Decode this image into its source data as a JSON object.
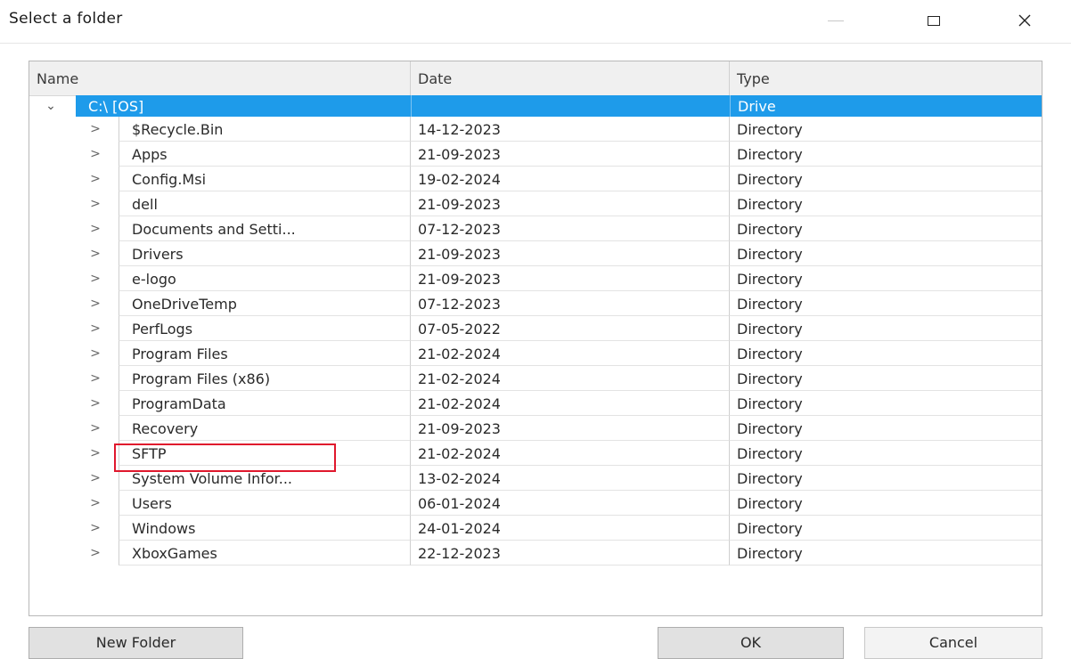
{
  "window": {
    "title": "Select a folder"
  },
  "columns": {
    "name": "Name",
    "date": "Date",
    "type": "Type"
  },
  "drive": {
    "name": "C:\\ [OS]",
    "type": "Drive",
    "selected": true
  },
  "folders": [
    {
      "name": "$Recycle.Bin",
      "date": "14-12-2023",
      "type": "Directory"
    },
    {
      "name": "Apps",
      "date": "21-09-2023",
      "type": "Directory"
    },
    {
      "name": "Config.Msi",
      "date": "19-02-2024",
      "type": "Directory"
    },
    {
      "name": "dell",
      "date": "21-09-2023",
      "type": "Directory"
    },
    {
      "name": "Documents and Setti...",
      "date": "07-12-2023",
      "type": "Directory"
    },
    {
      "name": "Drivers",
      "date": "21-09-2023",
      "type": "Directory"
    },
    {
      "name": "e-logo",
      "date": "21-09-2023",
      "type": "Directory"
    },
    {
      "name": "OneDriveTemp",
      "date": "07-12-2023",
      "type": "Directory"
    },
    {
      "name": "PerfLogs",
      "date": "07-05-2022",
      "type": "Directory"
    },
    {
      "name": "Program Files",
      "date": "21-02-2024",
      "type": "Directory"
    },
    {
      "name": "Program Files (x86)",
      "date": "21-02-2024",
      "type": "Directory"
    },
    {
      "name": "ProgramData",
      "date": "21-02-2024",
      "type": "Directory"
    },
    {
      "name": "Recovery",
      "date": "21-09-2023",
      "type": "Directory"
    },
    {
      "name": "SFTP",
      "date": "21-02-2024",
      "type": "Directory"
    },
    {
      "name": "System Volume Infor...",
      "date": "13-02-2024",
      "type": "Directory"
    },
    {
      "name": "Users",
      "date": "06-01-2024",
      "type": "Directory"
    },
    {
      "name": "Windows",
      "date": "24-01-2024",
      "type": "Directory"
    },
    {
      "name": "XboxGames",
      "date": "22-12-2023",
      "type": "Directory"
    }
  ],
  "buttons": {
    "new_folder": "New Folder",
    "ok": "OK",
    "cancel": "Cancel"
  },
  "icons": {
    "expand": "chevron-right-icon",
    "collapse": "chevron-down-icon",
    "minimize": "minimize-icon",
    "maximize": "maximize-icon",
    "close": "close-icon"
  },
  "colors": {
    "selection": "#1e9bea",
    "annotation": "#e0182d"
  }
}
